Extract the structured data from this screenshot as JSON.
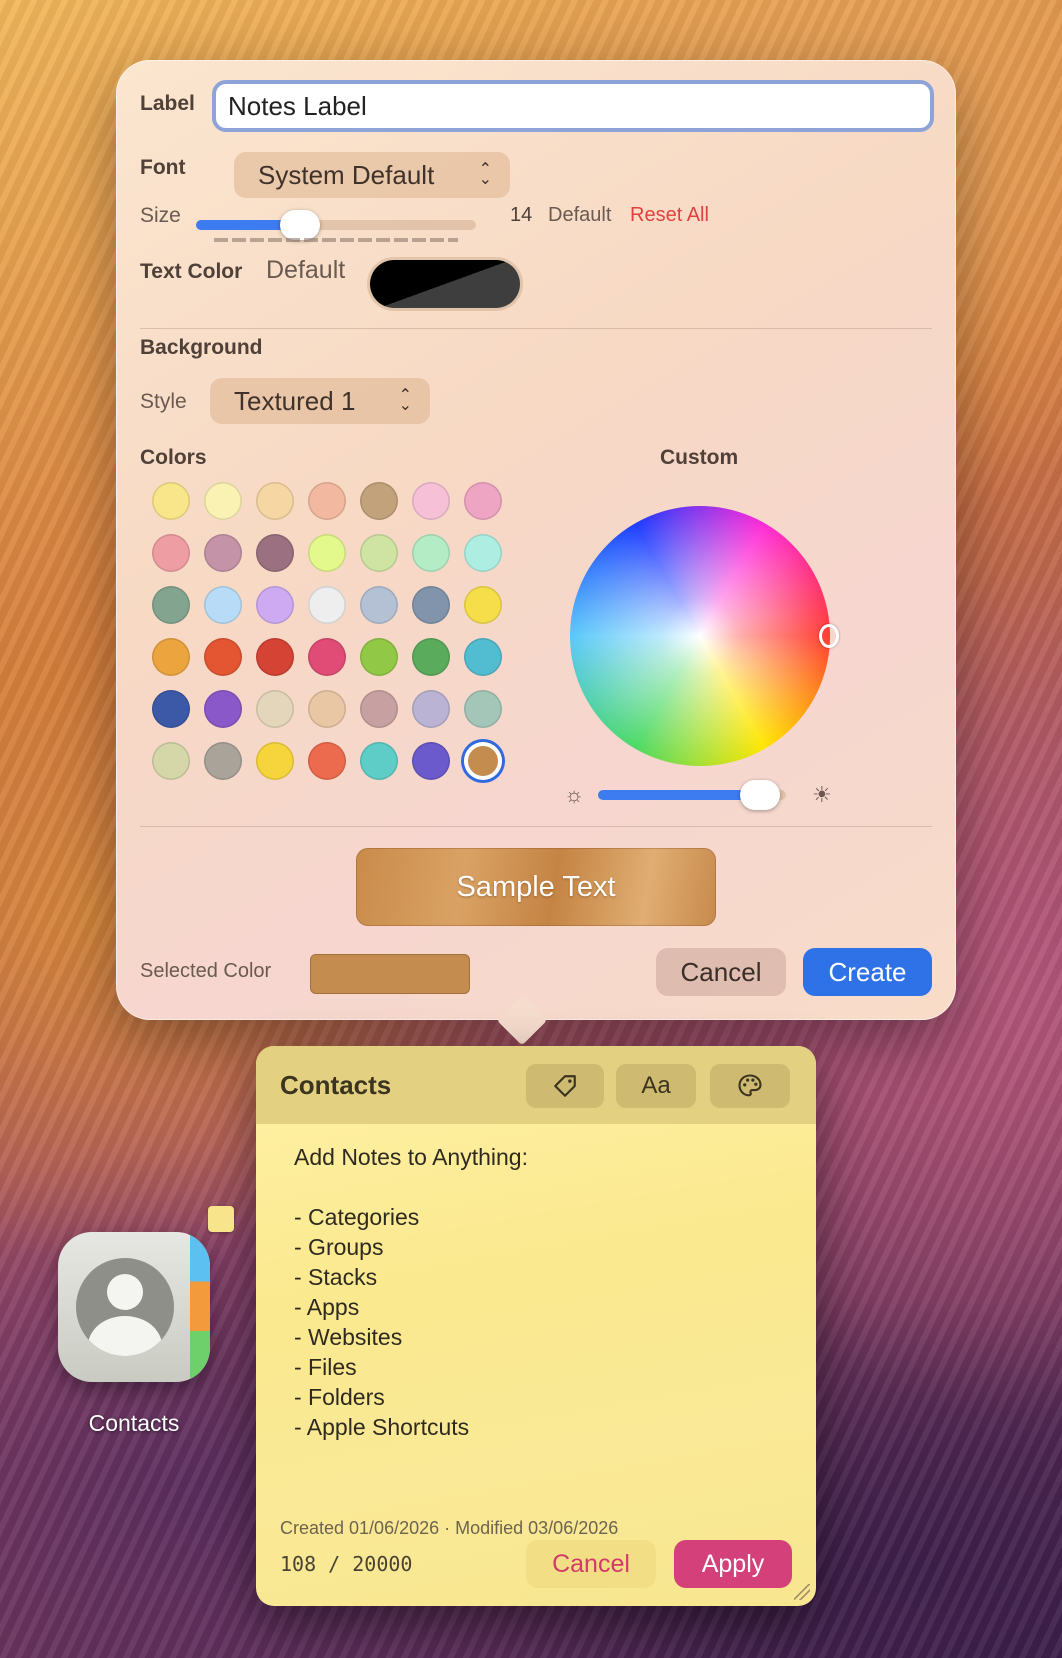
{
  "popover": {
    "label_title": "Label",
    "label_value": "Notes Label",
    "font_title": "Font",
    "font_value": "System Default",
    "size_title": "Size",
    "size_value": "14",
    "size_default": "Default",
    "size_slider_fraction": 0.37,
    "reset_all": "Reset All",
    "text_color_title": "Text Color",
    "text_color_value": "Default",
    "background_title": "Background",
    "style_title": "Style",
    "style_value": "Textured 1",
    "colors_title": "Colors",
    "custom_title": "Custom",
    "brightness_fraction": 0.86,
    "sample_text": "Sample Text",
    "selected_color_title": "Selected Color",
    "selected_color_hex": "#c48c4f",
    "cancel_label": "Cancel",
    "create_label": "Create"
  },
  "swatches": [
    [
      "#f9e58a",
      "#faf2b3",
      "#f6d7a3",
      "#f2b9a0",
      "#c2a27b",
      "#f6c1d6",
      "#eea5c3"
    ],
    [
      "#ee9ea3",
      "#c493a8",
      "#9b7080",
      "#e3f98c",
      "#cfe4a3",
      "#b4ecc6",
      "#aeeee2"
    ],
    [
      "#83a48e",
      "#b8dcf7",
      "#cdaaf2",
      "#eeeeee",
      "#b4c1d4",
      "#8194ac",
      "#f6dd4a"
    ],
    [
      "#eca43f",
      "#e45632",
      "#d44334",
      "#e04c76",
      "#91c946",
      "#5aac5c",
      "#52bcd0"
    ],
    [
      "#3c59a8",
      "#8b58c9",
      "#e3d6bb",
      "#e9c6a4",
      "#c7a1a1",
      "#bab3d3",
      "#a3c6b8"
    ],
    [
      "#d5d7a8",
      "#a9a39a",
      "#f6d53c",
      "#ec6b4e",
      "#5fcdc7",
      "#6a5acb",
      "#c48c4f"
    ]
  ],
  "selected_swatch_index": [
    5,
    6
  ],
  "note": {
    "title": "Contacts",
    "tool_label": "Aa",
    "lines": [
      "Add Notes to Anything:",
      "",
      "- Categories",
      "- Groups",
      "- Stacks",
      "- Apps",
      "- Websites",
      "- Files",
      "- Folders",
      "- Apple Shortcuts"
    ],
    "meta": "Created 01/06/2026  ·  Modified 03/06/2026",
    "count": "108 / 20000",
    "cancel_label": "Cancel",
    "apply_label": "Apply"
  },
  "app": {
    "name": "Contacts"
  }
}
